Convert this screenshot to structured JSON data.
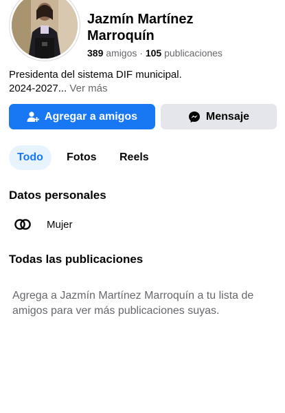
{
  "profile": {
    "name": "Jazmín Martínez Marroquín",
    "friends_count": "389",
    "friends_label": "amigos",
    "separator": "·",
    "posts_count": "105",
    "posts_label": "publicaciones",
    "bio_line1": "Presidenta del sistema DIF municipal.",
    "bio_line2": "2024-2027...",
    "see_more": "Ver más"
  },
  "actions": {
    "add_friend": "Agregar a amigos",
    "message": "Mensaje"
  },
  "tabs": [
    {
      "label": "Todo",
      "active": true
    },
    {
      "label": "Fotos",
      "active": false
    },
    {
      "label": "Reels",
      "active": false
    }
  ],
  "personal": {
    "title": "Datos personales",
    "gender": "Mujer"
  },
  "posts": {
    "title": "Todas las publicaciones",
    "empty_message": "Agrega a Jazmín Martínez Marroquín a tu lista de amigos para ver más publicaciones suyas."
  },
  "colors": {
    "primary": "#1877f2",
    "secondary_button": "#e4e6eb",
    "active_tab_bg": "#e7f3ff",
    "muted_text": "#65676b"
  },
  "icons": {
    "add_friend": "add-person-icon",
    "message": "messenger-icon",
    "gender": "gender-rings-icon"
  }
}
